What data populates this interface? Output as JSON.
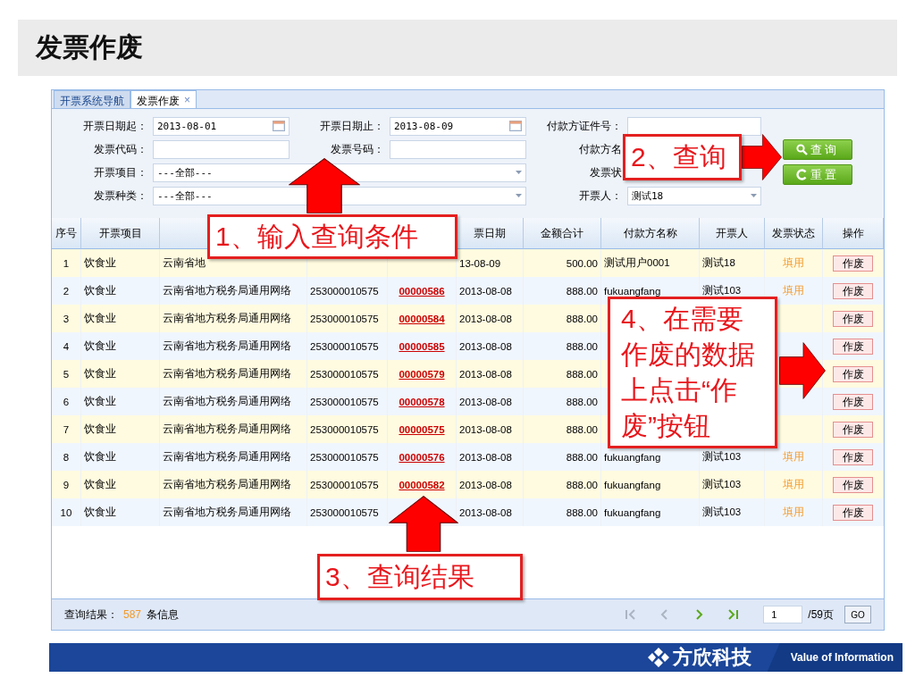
{
  "title": "发票作废",
  "tabs": [
    {
      "label": "开票系统导航",
      "selected": false
    },
    {
      "label": "发票作废",
      "selected": true,
      "close": "×"
    }
  ],
  "filter_rows": [
    [
      {
        "kind": "date",
        "label": "开票日期起：",
        "value": "2013-08-01"
      },
      {
        "kind": "date",
        "label": "开票日期止：",
        "value": "2013-08-09"
      },
      {
        "kind": "text",
        "label": "付款方证件号："
      }
    ],
    [
      {
        "kind": "text",
        "label": "发票代码："
      },
      {
        "kind": "text",
        "label": "发票号码："
      },
      {
        "kind": "label",
        "label": "付款方名"
      }
    ],
    [
      {
        "kind": "wide-combo",
        "label": "开票项目：",
        "value": "---全部---"
      },
      {
        "kind": "label",
        "label": "发票状"
      }
    ],
    [
      {
        "kind": "wide-combo",
        "label": "发票种类：",
        "value": "---全部---"
      },
      {
        "kind": "combo",
        "label": "开票人：",
        "value": "测试18"
      }
    ]
  ],
  "buttons": [
    {
      "kind": "search",
      "label": "查询"
    },
    {
      "kind": "reset",
      "label": "重置"
    }
  ],
  "table": {
    "columns": [
      {
        "label": "序号"
      },
      {
        "label": "开票项目"
      },
      {},
      {},
      {},
      {
        "label": "票日期"
      },
      {
        "label": "金额合计"
      },
      {
        "label": "付款方名称"
      },
      {
        "label": "开票人"
      },
      {
        "label": "发票状态"
      },
      {
        "label": "操作"
      }
    ],
    "rows": [
      {
        "no": "1",
        "item": "饮食业",
        "name": "云南省地",
        "date": "13-08-09",
        "amount": "500.00",
        "payer": "测试用户0001",
        "issuer": "测试18",
        "status": "填用",
        "action": "作废"
      },
      {
        "no": "2",
        "item": "饮食业",
        "name": "云南省地方税务局通用网络",
        "code": "253000010575",
        "number": "00000586",
        "date": "2013-08-08",
        "amount": "888.00",
        "payer": "fukuangfang",
        "issuer": "测试103",
        "status": "填用",
        "action": "作废"
      },
      {
        "no": "3",
        "item": "饮食业",
        "name": "云南省地方税务局通用网络",
        "code": "253000010575",
        "number": "00000584",
        "date": "2013-08-08",
        "amount": "888.00",
        "action": "作废"
      },
      {
        "no": "4",
        "item": "饮食业",
        "name": "云南省地方税务局通用网络",
        "code": "253000010575",
        "number": "00000585",
        "date": "2013-08-08",
        "amount": "888.00",
        "action": "作废"
      },
      {
        "no": "5",
        "item": "饮食业",
        "name": "云南省地方税务局通用网络",
        "code": "253000010575",
        "number": "00000579",
        "date": "2013-08-08",
        "amount": "888.00",
        "action": "作废"
      },
      {
        "no": "6",
        "item": "饮食业",
        "name": "云南省地方税务局通用网络",
        "code": "253000010575",
        "number": "00000578",
        "date": "2013-08-08",
        "amount": "888.00",
        "action": "作废"
      },
      {
        "no": "7",
        "item": "饮食业",
        "name": "云南省地方税务局通用网络",
        "code": "253000010575",
        "number": "00000575",
        "date": "2013-08-08",
        "amount": "888.00",
        "action": "作废"
      },
      {
        "no": "8",
        "item": "饮食业",
        "name": "云南省地方税务局通用网络",
        "code": "253000010575",
        "number": "00000576",
        "date": "2013-08-08",
        "amount": "888.00",
        "payer": "fukuangfang",
        "issuer": "测试103",
        "status": "填用",
        "action": "作废"
      },
      {
        "no": "9",
        "item": "饮食业",
        "name": "云南省地方税务局通用网络",
        "code": "253000010575",
        "number": "00000582",
        "date": "2013-08-08",
        "amount": "888.00",
        "payer": "fukuangfang",
        "issuer": "测试103",
        "status": "填用",
        "action": "作废"
      },
      {
        "no": "10",
        "item": "饮食业",
        "name": "云南省地方税务局通用网络",
        "code": "253000010575",
        "date": "2013-08-08",
        "amount": "888.00",
        "payer": "fukuangfang",
        "issuer": "测试103",
        "status": "填用",
        "action": "作废"
      }
    ]
  },
  "footer": {
    "label": "查询结果：",
    "count": "587",
    "suffix": "条信息",
    "pager": [
      {
        "kind": "first",
        "disabled": true
      },
      {
        "kind": "prev",
        "disabled": true
      },
      {
        "kind": "next",
        "disabled": false
      },
      {
        "kind": "last",
        "disabled": false
      }
    ],
    "page": "1",
    "pages": "/59页",
    "go": "GO"
  },
  "callouts": [
    {
      "text": "1、输入查询条件",
      "kind": "up"
    },
    {
      "text": "2、查询",
      "kind": "right"
    },
    {
      "text": "3、查询结果",
      "kind": "up"
    },
    {
      "text": "4、在需要作废的数据上点击“作废”按钮",
      "kind": "right"
    }
  ],
  "brand": {
    "name": "方欣科技",
    "slogan": "Value of Information"
  }
}
